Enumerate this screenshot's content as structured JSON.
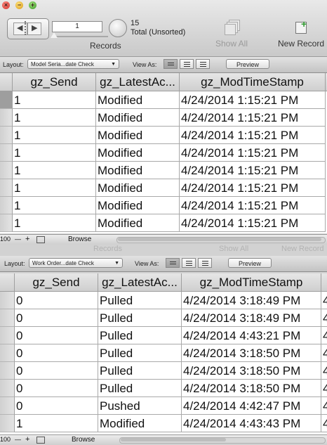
{
  "window1": {
    "toolbar": {
      "record_number": "1",
      "total_count": "15",
      "total_label": "Total (Unsorted)",
      "records_label": "Records",
      "show_all_label": "Show All",
      "new_record_label": "New Record"
    },
    "layoutbar": {
      "layout_label": "Layout:",
      "layout_value": "Model Seria...date Check",
      "view_as_label": "View As:",
      "preview_label": "Preview"
    },
    "columns": [
      "gz_Send",
      "gz_LatestAc...",
      "gz_ModTimeStamp"
    ],
    "rows": [
      [
        "1",
        "Modified",
        "4/24/2014 1:15:21 PM"
      ],
      [
        "1",
        "Modified",
        "4/24/2014 1:15:21 PM"
      ],
      [
        "1",
        "Modified",
        "4/24/2014 1:15:21 PM"
      ],
      [
        "1",
        "Modified",
        "4/24/2014 1:15:21 PM"
      ],
      [
        "1",
        "Modified",
        "4/24/2014 1:15:21 PM"
      ],
      [
        "1",
        "Modified",
        "4/24/2014 1:15:21 PM"
      ],
      [
        "1",
        "Modified",
        "4/24/2014 1:15:21 PM"
      ],
      [
        "1",
        "Modified",
        "4/24/2014 1:15:21 PM"
      ]
    ],
    "statusbar": {
      "zoom": "100",
      "mode": "Browse"
    }
  },
  "window2": {
    "partial_labels": {
      "records": "Records",
      "show_all": "Show All",
      "new_record": "New Record"
    },
    "layoutbar": {
      "layout_label": "Layout:",
      "layout_value": "Work Order...date Check",
      "view_as_label": "View As:",
      "preview_label": "Preview"
    },
    "columns": [
      "gz_Send",
      "gz_LatestAc...",
      "gz_ModTimeStamp"
    ],
    "extra_column_glyph": "4",
    "rows": [
      [
        "0",
        "Pulled",
        "4/24/2014 3:18:49 PM"
      ],
      [
        "0",
        "Pulled",
        "4/24/2014 3:18:49 PM"
      ],
      [
        "0",
        "Pulled",
        "4/24/2014 4:43:21 PM"
      ],
      [
        "0",
        "Pulled",
        "4/24/2014 3:18:50 PM"
      ],
      [
        "0",
        "Pulled",
        "4/24/2014 3:18:50 PM"
      ],
      [
        "0",
        "Pulled",
        "4/24/2014 3:18:50 PM"
      ],
      [
        "0",
        "Pushed",
        "4/24/2014 4:42:47 PM"
      ],
      [
        "1",
        "Modified",
        "4/24/2014 4:43:43 PM"
      ]
    ],
    "statusbar": {
      "zoom": "100",
      "mode": "Browse"
    }
  },
  "traffic_lights": {
    "close": "×",
    "minimize": "−",
    "zoom": "+"
  }
}
